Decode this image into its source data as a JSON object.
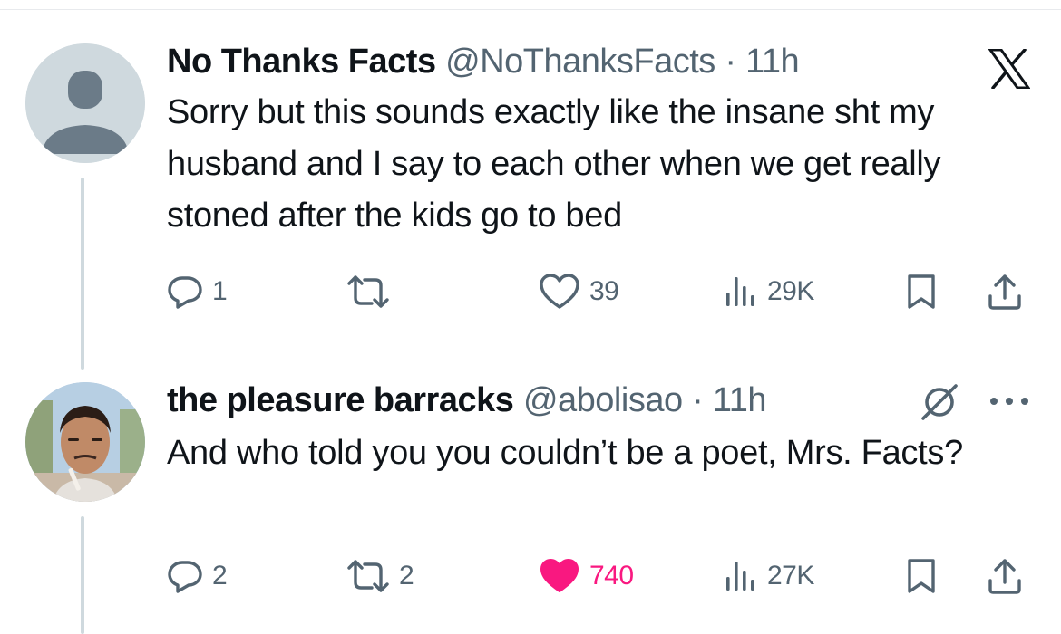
{
  "tweets": [
    {
      "name": "No Thanks Facts",
      "handle": "@NoThanksFacts",
      "separator": "·",
      "time": "11h",
      "text": "Sorry but this sounds exactly like the insane sht my husband and I say to each other when we get really stoned after the kids go to bed",
      "header_icon": "x-logo-icon",
      "avatar": "default-avatar-icon",
      "stats": {
        "replies": "1",
        "retweets": "",
        "likes": "39",
        "views": "29K"
      },
      "liked": false
    },
    {
      "name": "the pleasure barracks",
      "handle": "@abolisao",
      "separator": "·",
      "time": "11h",
      "text": "And who told you you couldn’t be a poet, Mrs. Facts?",
      "header_icon": "grok-icon",
      "more_icon": "more-options-icon",
      "avatar": "profile-photo",
      "stats": {
        "replies": "2",
        "retweets": "2",
        "likes": "740",
        "views": "27K"
      },
      "liked": true
    }
  ],
  "colors": {
    "text_primary": "#0f1419",
    "text_secondary": "#536471",
    "like_active": "#f91880",
    "thread_line": "#cfd9de"
  }
}
